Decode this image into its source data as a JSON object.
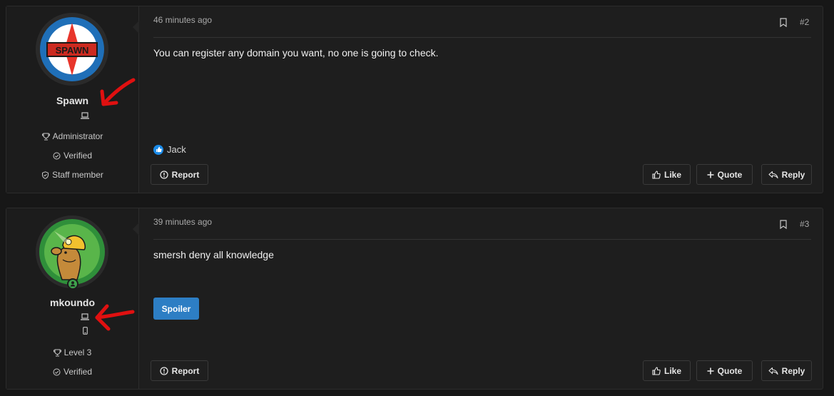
{
  "posts": [
    {
      "username": "Spawn",
      "credentials": [
        "Administrator",
        "Verified",
        "Staff member"
      ],
      "time": "46 minutes ago",
      "post_number": "#2",
      "body": "You can register any domain you want, no one is going to check.",
      "reactions": {
        "users": "Jack",
        "icon": "like-reaction-icon"
      },
      "avatar": {
        "text": "SPAWN",
        "colors": {
          "ring": "#1f6fb8",
          "star": "#e8352b",
          "band": "#cc2a20"
        }
      },
      "buttons": {
        "report": "Report",
        "like": "Like",
        "quote": "Quote",
        "reply": "Reply"
      }
    },
    {
      "username": "mkoundo",
      "credentials": [
        "Level 3",
        "Verified"
      ],
      "time": "39 minutes ago",
      "post_number": "#3",
      "body": "smersh deny all knowledge",
      "spoiler_label": "Spoiler",
      "avatar": {
        "colors": {
          "ring": "#2f8f3a",
          "inner": "#59b54a",
          "mole": "#c48a3a",
          "helmet": "#f2c12e"
        }
      },
      "buttons": {
        "report": "Report",
        "like": "Like",
        "quote": "Quote",
        "reply": "Reply"
      }
    }
  ],
  "colors": {
    "accent": "#2d7ec4",
    "annotation": "#e01010",
    "reaction": "#1b8be8"
  }
}
